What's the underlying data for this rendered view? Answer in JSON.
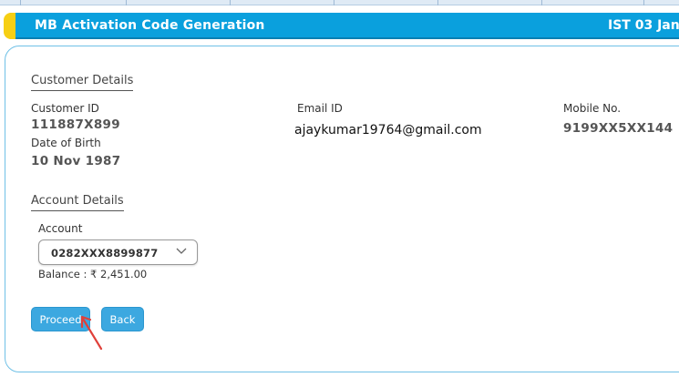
{
  "header": {
    "title": "MB Activation Code Generation",
    "date": "IST 03 Jan",
    "color": "#0aa0dd",
    "accent": "#f6cf14"
  },
  "customer": {
    "section_title": "Customer Details",
    "customer_id_label": "Customer ID",
    "customer_id": "111887X899",
    "dob_label": "Date of Birth",
    "dob": "10 Nov 1987",
    "email_label": "Email ID",
    "email": "ajaykumar19764@gmail.com",
    "mobile_label": "Mobile No.",
    "mobile": "9199XX5XX144"
  },
  "account": {
    "section_title": "Account Details",
    "account_label": "Account",
    "selected_account": "0282XXX8899877",
    "balance_text": "Balance : ₹ 2,451.00"
  },
  "actions": {
    "proceed_label": "Proceed",
    "back_label": "Back",
    "button_color": "#3ca8e0"
  }
}
